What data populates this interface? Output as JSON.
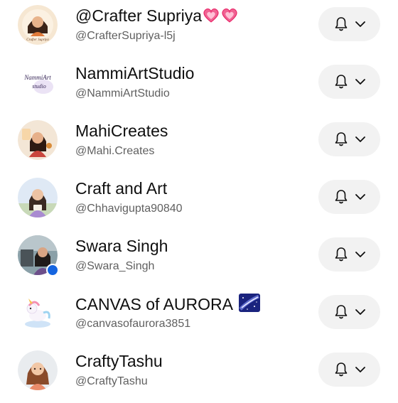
{
  "subscriptions": [
    {
      "name": "@Crafter Supriya",
      "handle": "@CrafterSupriya-l5j",
      "name_suffix_icons": [
        "sparkling-heart-icon",
        "sparkling-heart-icon"
      ],
      "avatar_text": "Crafter Supriya"
    },
    {
      "name": "NammiArtStudio",
      "handle": "@NammiArtStudio",
      "avatar_text_line1": "NammiArt",
      "avatar_text_line2": "studio"
    },
    {
      "name": "MahiCreates",
      "handle": "@Mahi.Creates"
    },
    {
      "name": "Craft and Art",
      "handle": "@Chhavigupta90840"
    },
    {
      "name": "Swara Singh",
      "handle": "@Swara_Singh",
      "live_indicator": true
    },
    {
      "name": "CANVAS of AURORA",
      "handle": "@canvasofaurora3851",
      "name_suffix_icons": [
        "milky-way-icon"
      ]
    },
    {
      "name": "CraftyTashu",
      "handle": "@CraftyTashu"
    }
  ],
  "colors": {
    "name_text": "#0f0f0f",
    "handle_text": "#606060",
    "button_bg": "#f2f2f2",
    "live_dot": "#1565e0",
    "heart_pink": "#f06292"
  },
  "icons": {
    "notification": "bell-icon",
    "dropdown": "chevron-down-icon"
  }
}
